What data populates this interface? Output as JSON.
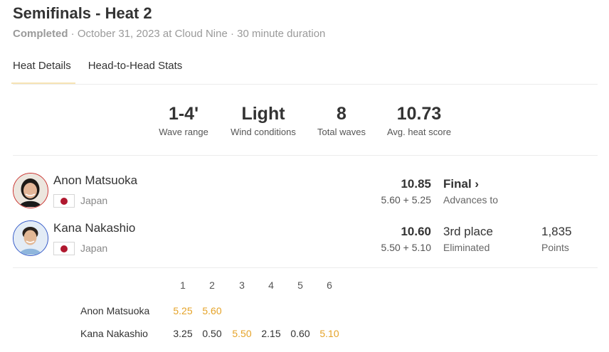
{
  "header": {
    "title": "Semifinals - Heat 2",
    "status": "Completed",
    "details": " · October 31, 2023 at Cloud Nine · 30 minute duration"
  },
  "tabs": [
    {
      "label": "Heat Details",
      "active": true
    },
    {
      "label": "Head-to-Head Stats",
      "active": false
    }
  ],
  "stats": [
    {
      "value": "1-4'",
      "label": "Wave range"
    },
    {
      "value": "Light",
      "label": "Wind conditions"
    },
    {
      "value": "8",
      "label": "Total waves"
    },
    {
      "value": "10.73",
      "label": "Avg. heat score"
    }
  ],
  "athletes": [
    {
      "name": "Anon Matsuoka",
      "country": "Japan",
      "total": "10.85",
      "breakdown": "5.60 + 5.25",
      "result": "Final",
      "result_icon": "chevron-right-icon",
      "result_sub": "Advances to",
      "points": "",
      "points_label": "",
      "avatar_color": "#c9302c"
    },
    {
      "name": "Kana Nakashio",
      "country": "Japan",
      "total": "10.60",
      "breakdown": "5.50 + 5.10",
      "result": "3rd place",
      "result_sub": "Eliminated",
      "points": "1,835",
      "points_label": "Points",
      "avatar_color": "#2e56c8"
    }
  ],
  "waves": {
    "headers": [
      "1",
      "2",
      "3",
      "4",
      "5",
      "6"
    ],
    "rows": [
      {
        "name": "Anon Matsuoka",
        "scores": [
          "5.25",
          "5.60",
          "",
          "",
          "",
          ""
        ],
        "counted": [
          true,
          true,
          false,
          false,
          false,
          false
        ]
      },
      {
        "name": "Kana Nakashio",
        "scores": [
          "3.25",
          "0.50",
          "5.50",
          "2.15",
          "0.60",
          "5.10"
        ],
        "counted": [
          false,
          false,
          true,
          false,
          false,
          true
        ]
      }
    ]
  },
  "colors": {
    "counting_wave": "#e5a328",
    "tab_underline": "#f6e3b4",
    "flag_red": "#b0182f"
  }
}
